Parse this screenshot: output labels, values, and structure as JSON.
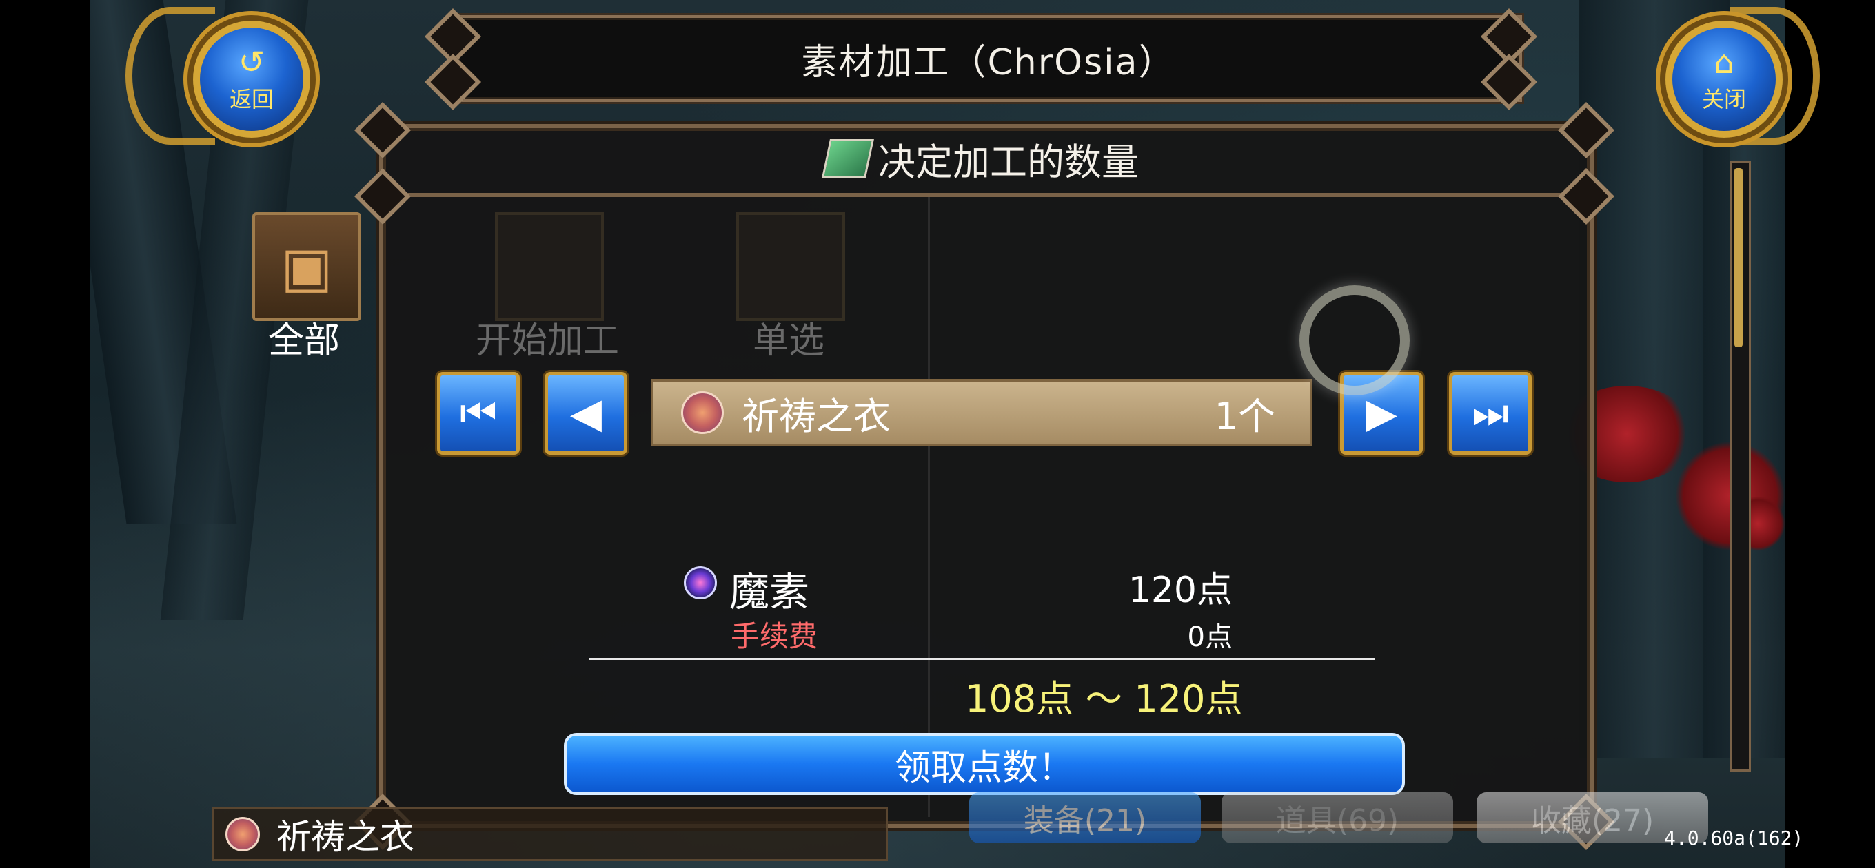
{
  "header": {
    "title": "素材加工（ChrOsia）",
    "back_label": "返回",
    "close_label": "关闭"
  },
  "sidebar": {
    "all_label": "全部"
  },
  "toolbar": {
    "start_label": "开始加工",
    "single_label": "单选"
  },
  "dialog": {
    "title": "决定加工的数量"
  },
  "selector": {
    "item_name": "祈祷之衣",
    "quantity": "1个"
  },
  "points": {
    "element_name": "魔素",
    "element_value": "120点",
    "fee_label": "手续费",
    "fee_value": "0点",
    "range_text": "108点 ～ 120点",
    "claim_label": "领取点数！"
  },
  "bottom": {
    "selected_item": "祈祷之衣",
    "tabs": [
      "装备(21)",
      "道具(69)",
      "收藏(27)"
    ]
  },
  "version": "4.0.60a(162)",
  "colors": {
    "fee_red": "#ff6b6b",
    "range_yellow": "#f7f27a",
    "button_blue": "#1a78f2",
    "frame_gold": "#c99a35"
  }
}
